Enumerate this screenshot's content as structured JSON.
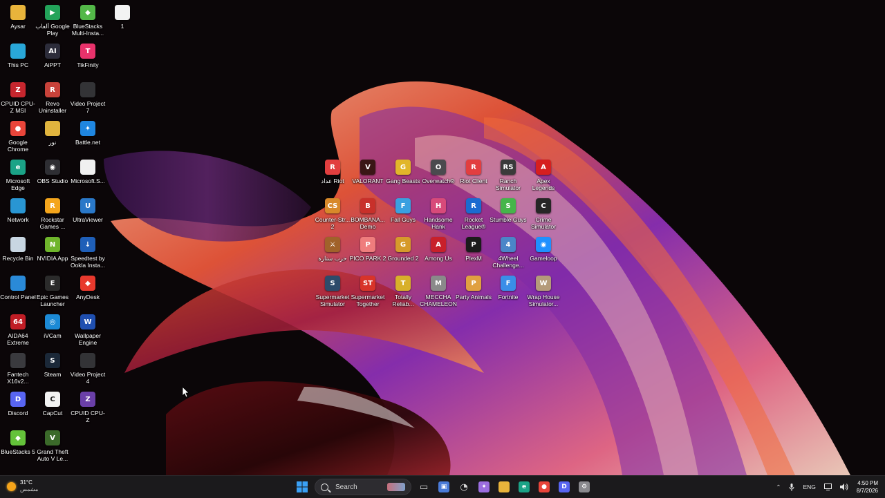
{
  "desktop": {
    "icons": [
      {
        "label": "Aysar",
        "icon": "folder-icon",
        "color": "#e9b43b",
        "glyph": ""
      },
      {
        "label": "ألعاب Google Play",
        "icon": "google-play-games-icon",
        "color": "#23a35a",
        "glyph": "▶"
      },
      {
        "label": "BlueStacks Multi-Insta...",
        "icon": "bluestacks-icon",
        "color": "#53b848",
        "glyph": "◆"
      },
      {
        "label": "1",
        "icon": "file-icon",
        "color": "#f3f3f3",
        "glyph": ""
      },
      {
        "label": "This PC",
        "icon": "monitor-icon",
        "color": "#29a7d8",
        "glyph": ""
      },
      {
        "label": "AiPPT",
        "icon": "aippt-icon",
        "color": "#2c2c3a",
        "glyph": "AI"
      },
      {
        "label": "TikFinity",
        "icon": "tikfinity-icon",
        "color": "#e8326b",
        "glyph": "T"
      },
      {
        "label": "CPUID CPU-Z MSI",
        "icon": "cpuz-msi-icon",
        "color": "#c6262e",
        "glyph": "Z"
      },
      {
        "label": "Revo Uninstaller",
        "icon": "revo-uninstaller-icon",
        "color": "#c8423a",
        "glyph": "R"
      },
      {
        "label": "Video Project 7",
        "icon": "video-project-icon",
        "color": "#333336",
        "glyph": ""
      },
      {
        "label": "Google Chrome",
        "icon": "chrome-icon",
        "color": "#e9453a",
        "glyph": "●"
      },
      {
        "label": "نور",
        "icon": "folder-icon",
        "color": "#e0b43e",
        "glyph": ""
      },
      {
        "label": "Battle.net",
        "icon": "battlenet-icon",
        "color": "#1f86e0",
        "glyph": "✦"
      },
      {
        "label": "Microsoft Edge",
        "icon": "edge-icon",
        "color": "#1ba387",
        "glyph": "e"
      },
      {
        "label": "OBS Studio",
        "icon": "obs-icon",
        "color": "#2e2e33",
        "glyph": "◉"
      },
      {
        "label": "Microsoft.S...",
        "icon": "file-icon",
        "color": "#f0f0f0",
        "glyph": ""
      },
      {
        "label": "Network",
        "icon": "network-icon",
        "color": "#2996d3",
        "glyph": ""
      },
      {
        "label": "Rockstar Games ...",
        "icon": "rockstar-icon",
        "color": "#f4a51c",
        "glyph": "R"
      },
      {
        "label": "UltraViewer",
        "icon": "ultraviewer-icon",
        "color": "#2a78c8",
        "glyph": "U"
      },
      {
        "label": "Recycle Bin",
        "icon": "recycle-bin-icon",
        "color": "#c8d6e2",
        "glyph": ""
      },
      {
        "label": "NVIDIA App",
        "icon": "nvidia-icon",
        "color": "#6fb52c",
        "glyph": "N"
      },
      {
        "label": "Speedtest by Ookla Insta...",
        "icon": "download-icon",
        "color": "#1f5fb8",
        "glyph": "↓"
      },
      {
        "label": "Control Panel",
        "icon": "control-panel-icon",
        "color": "#2a8ad8",
        "glyph": ""
      },
      {
        "label": "Epic Games Launcher",
        "icon": "epic-games-icon",
        "color": "#2b2b2b",
        "glyph": "E"
      },
      {
        "label": "AnyDesk",
        "icon": "anydesk-icon",
        "color": "#e8392d",
        "glyph": "◆"
      },
      {
        "label": "AIDA64 Extreme",
        "icon": "aida64-icon",
        "color": "#c01d25",
        "glyph": "64"
      },
      {
        "label": "iVCam",
        "icon": "ivcam-icon",
        "color": "#1c8ad6",
        "glyph": "◎"
      },
      {
        "label": "Wallpaper Engine",
        "icon": "wallpaper-engine-icon",
        "color": "#1f4fb0",
        "glyph": "W"
      },
      {
        "label": "Fantech X16v2...",
        "icon": "mouse-icon",
        "color": "#3a3a3e",
        "glyph": ""
      },
      {
        "label": "Steam",
        "icon": "steam-icon",
        "color": "#1b2838",
        "glyph": "S"
      },
      {
        "label": "Video Project 4",
        "icon": "video-project-icon",
        "color": "#333336",
        "glyph": ""
      },
      {
        "label": "Discord",
        "icon": "discord-icon",
        "color": "#5865f2",
        "glyph": "D"
      },
      {
        "label": "CapCut",
        "icon": "capcut-icon",
        "color": "#f2f2f2",
        "glyph": "C"
      },
      {
        "label": "CPUID CPU-Z",
        "icon": "cpuz-icon",
        "color": "#6a3fa8",
        "glyph": "Z"
      },
      {
        "label": "BlueStacks 5",
        "icon": "bluestacks-icon",
        "color": "#64c23a",
        "glyph": "◆"
      },
      {
        "label": "Grand Theft Auto V Le...",
        "icon": "gta-v-icon",
        "color": "#3b6a2a",
        "glyph": "V"
      },
      {
        "label": "عداد Riot",
        "icon": "riot-icon",
        "color": "#e23e3f",
        "glyph": "R"
      },
      {
        "label": "VALORANT",
        "icon": "valorant-icon",
        "color": "#3a1616",
        "glyph": "V"
      },
      {
        "label": "Gang Beasts",
        "icon": "gang-beasts-icon",
        "color": "#e1b62a",
        "glyph": "G"
      },
      {
        "label": "Overwatch®",
        "icon": "overwatch-icon",
        "color": "#4a4a4e",
        "glyph": "O"
      },
      {
        "label": "Riot Client",
        "icon": "riot-client-icon",
        "color": "#e23e3f",
        "glyph": "R"
      },
      {
        "label": "Ranch Simulator",
        "icon": "ranch-simulator-icon",
        "color": "#3a3a3a",
        "glyph": "RS"
      },
      {
        "label": "Apex Legends",
        "icon": "apex-icon",
        "color": "#d61f1f",
        "glyph": "A"
      },
      {
        "label": "Counter-Str... 2",
        "icon": "counter-strike-icon",
        "color": "#d8892a",
        "glyph": "CS"
      },
      {
        "label": "BOMBANA... Demo",
        "icon": "bombana-icon",
        "color": "#c8302a",
        "glyph": "B"
      },
      {
        "label": "Fall Guys",
        "icon": "fall-guys-icon",
        "color": "#3aa0e0",
        "glyph": "F"
      },
      {
        "label": "Handsome Hank",
        "icon": "handsome-hank-icon",
        "color": "#d84a7a",
        "glyph": "H"
      },
      {
        "label": "Rocket League®",
        "icon": "rocket-league-icon",
        "color": "#1b6bd0",
        "glyph": "R"
      },
      {
        "label": "Stumble Guys",
        "icon": "stumble-guys-icon",
        "color": "#45b54a",
        "glyph": "S"
      },
      {
        "label": "Crime Simulator",
        "icon": "crime-simulator-icon",
        "color": "#262626",
        "glyph": "C"
      },
      {
        "label": "حرب ستارة",
        "icon": "game-icon",
        "color": "#a0622a",
        "glyph": "⚔"
      },
      {
        "label": "PICO PARK 2",
        "icon": "pico-park-icon",
        "color": "#ef7d7d",
        "glyph": "P"
      },
      {
        "label": "Grounded 2",
        "icon": "grounded-icon",
        "color": "#d69a2a",
        "glyph": "G"
      },
      {
        "label": "Among Us",
        "icon": "among-us-icon",
        "color": "#c8202a",
        "glyph": "A"
      },
      {
        "label": "PlexM",
        "icon": "plexm-icon",
        "color": "#1b1b1b",
        "glyph": "P"
      },
      {
        "label": "4Wheel Challenge...",
        "icon": "4wheel-icon",
        "color": "#4a86c8",
        "glyph": "4"
      },
      {
        "label": "Gameloop",
        "icon": "gameloop-icon",
        "color": "#1e90ff",
        "glyph": "◉"
      },
      {
        "label": "Supermarket Simulator",
        "icon": "supermarket-simulator-icon",
        "color": "#2d4b6a",
        "glyph": "S"
      },
      {
        "label": "Supermarket Together",
        "icon": "supermarket-together-icon",
        "color": "#d8342a",
        "glyph": "ST"
      },
      {
        "label": "Totally Reliab...",
        "icon": "totally-reliable-icon",
        "color": "#d8b02a",
        "glyph": "T"
      },
      {
        "label": "MECCHA CHAMELEON",
        "icon": "meccha-chameleon-icon",
        "color": "#8a8a8a",
        "glyph": "M"
      },
      {
        "label": "Party Animals",
        "icon": "party-animals-icon",
        "color": "#e0a040",
        "glyph": "P"
      },
      {
        "label": "Fortnite",
        "icon": "fortnite-icon",
        "color": "#3a8ee8",
        "glyph": "F"
      },
      {
        "label": "Wrap House Simulator...",
        "icon": "wrap-house-icon",
        "color": "#b49a7a",
        "glyph": "W"
      }
    ]
  },
  "taskbar": {
    "weather": {
      "temp": "31°C",
      "condition": "مشمس"
    },
    "search_placeholder": "Search",
    "pinned": [
      {
        "name": "start-button",
        "icon": "windows-icon",
        "color": "#2a8cf0",
        "glyph": "⊞"
      },
      {
        "name": "task-view-button",
        "icon": "task-view-icon",
        "color": "#d8d8d8",
        "glyph": "▭"
      },
      {
        "name": "app-monitor-button",
        "icon": "monitor-app-icon",
        "color": "#4a7bd8",
        "glyph": "▣"
      },
      {
        "name": "clock-app-button",
        "icon": "speed-icon",
        "color": "#d8d8d8",
        "glyph": "◔"
      },
      {
        "name": "copilot-button",
        "icon": "copilot-icon",
        "color": "#9b6de0",
        "glyph": "✦"
      },
      {
        "name": "file-explorer-button",
        "icon": "folder-icon",
        "color": "#e9b43b",
        "glyph": ""
      },
      {
        "name": "edge-button",
        "icon": "edge-icon",
        "color": "#1ba387",
        "glyph": "e"
      },
      {
        "name": "chrome-button",
        "icon": "chrome-icon",
        "color": "#e9453a",
        "glyph": "●"
      },
      {
        "name": "discord-button",
        "icon": "discord-icon",
        "color": "#5865f2",
        "glyph": "D"
      },
      {
        "name": "settings-button",
        "icon": "gear-icon",
        "color": "#8a8a8e",
        "glyph": "⚙"
      }
    ],
    "tray": {
      "language": "ENG"
    },
    "clock": {
      "time": "4:50 PM",
      "date": "8/7/2026"
    }
  },
  "colors": {
    "taskbar": "#1b1a1c",
    "accent": "#2a8cf0"
  }
}
